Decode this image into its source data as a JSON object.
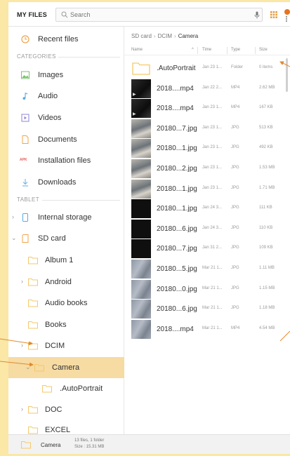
{
  "header": {
    "title": "MY FILES",
    "search_placeholder": "Search"
  },
  "sidebar": {
    "top": [
      {
        "label": "Recent files",
        "icon": "clock-icon"
      }
    ],
    "categories_heading": "CATEGORIES",
    "categories": [
      {
        "label": "Images",
        "icon": "image-icon",
        "color": "#7cc36e"
      },
      {
        "label": "Audio",
        "icon": "music-note-icon",
        "color": "#5aa8e0"
      },
      {
        "label": "Videos",
        "icon": "video-icon",
        "color": "#8f86d6"
      },
      {
        "label": "Documents",
        "icon": "document-icon",
        "color": "#f0a44b"
      },
      {
        "label": "Installation files",
        "icon": "apk-icon",
        "color": "#e05a5a",
        "icon_text": "APK"
      },
      {
        "label": "Downloads",
        "icon": "download-icon",
        "color": "#6fb5e8"
      }
    ],
    "tablet_heading": "TABLET",
    "storage": [
      {
        "label": "Internal storage",
        "icon": "phone-icon"
      },
      {
        "label": "SD card",
        "icon": "sd-card-icon"
      }
    ],
    "folders": [
      {
        "label": "Album 1"
      },
      {
        "label": "Android"
      },
      {
        "label": "Audio books"
      },
      {
        "label": "Books"
      },
      {
        "label": "DCIM"
      },
      {
        "label": "Camera"
      },
      {
        "label": ".AutoPortrait"
      },
      {
        "label": "DOC"
      },
      {
        "label": "EXCEL"
      }
    ]
  },
  "breadcrumb": {
    "items": [
      "SD card",
      "DCIM",
      "Camera"
    ]
  },
  "columns": {
    "name": "Name",
    "time": "Time",
    "type": "Type",
    "size": "Size"
  },
  "files": [
    {
      "name": ".AutoPortrait",
      "date": "Jan 23 1...",
      "type": "Folder",
      "size": "0 items",
      "thumb": "folder"
    },
    {
      "name": "2018....mp4",
      "date": "Jan 22 2...",
      "type": "MP4",
      "size": "2.62 MB",
      "thumb": "video"
    },
    {
      "name": "2018....mp4",
      "date": "Jan 23 1...",
      "type": "MP4",
      "size": "167 KB",
      "thumb": "video"
    },
    {
      "name": "20180...7.jpg",
      "date": "Jan 23 1...",
      "type": "JPG",
      "size": "513 KB",
      "thumb": "photo"
    },
    {
      "name": "20180...1.jpg",
      "date": "Jan 23 1...",
      "type": "JPG",
      "size": "492 KB",
      "thumb": "photo"
    },
    {
      "name": "20180...2.jpg",
      "date": "Jan 23 1...",
      "type": "JPG",
      "size": "1.53 MB",
      "thumb": "photo"
    },
    {
      "name": "20180...1.jpg",
      "date": "Jan 23 1...",
      "type": "JPG",
      "size": "1.71 MB",
      "thumb": "photo"
    },
    {
      "name": "20180...1.jpg",
      "date": "Jan 24 3...",
      "type": "JPG",
      "size": "111 KB",
      "thumb": "dark"
    },
    {
      "name": "20180...6.jpg",
      "date": "Jan 24 3...",
      "type": "JPG",
      "size": "110 KB",
      "thumb": "dark"
    },
    {
      "name": "20180...7.jpg",
      "date": "Jan 31 2...",
      "type": "JPG",
      "size": "109 KB",
      "thumb": "dark"
    },
    {
      "name": "20180...5.jpg",
      "date": "Mar 21 1...",
      "type": "JPG",
      "size": "1.11 MB",
      "thumb": "wall"
    },
    {
      "name": "20180...0.jpg",
      "date": "Mar 21 1...",
      "type": "JPG",
      "size": "1.15 MB",
      "thumb": "wall"
    },
    {
      "name": "20180...6.jpg",
      "date": "Mar 21 1...",
      "type": "JPG",
      "size": "1.18 MB",
      "thumb": "wall"
    },
    {
      "name": "2018....mp4",
      "date": "Mar 21 1...",
      "type": "MP4",
      "size": "4.54 MB",
      "thumb": "wall"
    }
  ],
  "status": {
    "folder": "Camera",
    "info_line1": "13 files, 1 folder",
    "info_line2": "Size : 15.31 MB"
  },
  "colors": {
    "accent": "#f6dba3",
    "folder": "#f5c96a",
    "callout": "#e08a2e",
    "page_bg": "#fbe7a6"
  }
}
